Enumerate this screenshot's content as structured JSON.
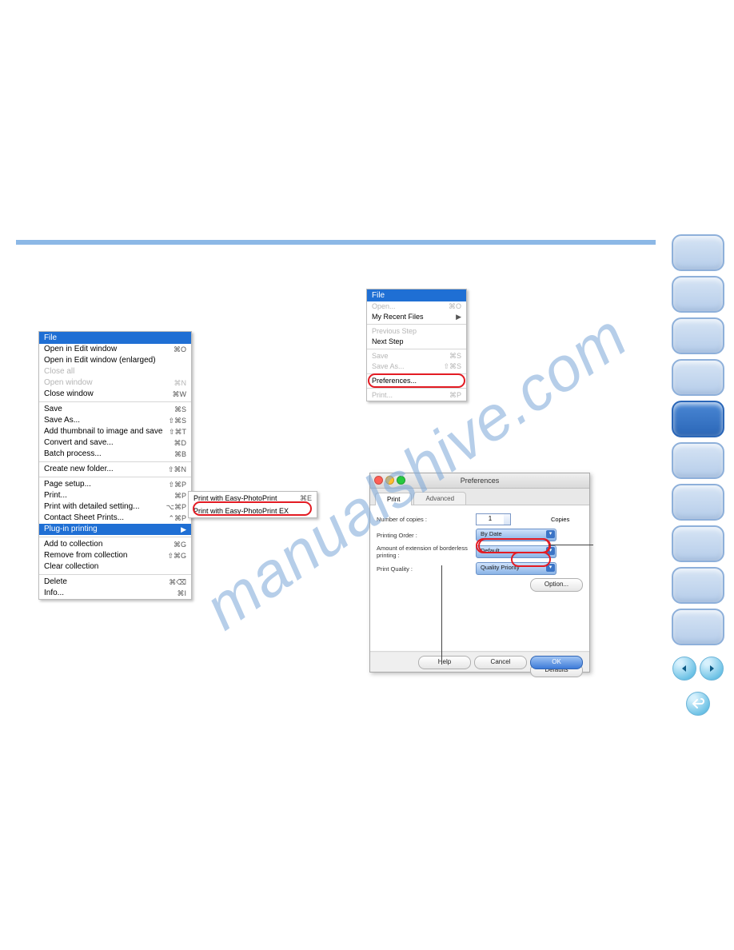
{
  "watermark": "manualshive.com",
  "menu1": {
    "title": "File",
    "rows": [
      {
        "label": "Open in Edit window",
        "sc": "⌘O"
      },
      {
        "label": "Open in Edit window (enlarged)",
        "sc": ""
      },
      {
        "label": "Close all",
        "sc": "",
        "disabled": true
      },
      {
        "label": "Open window",
        "sc": "⌘N",
        "disabled": true
      },
      {
        "label": "Close window",
        "sc": "⌘W"
      },
      {
        "sep": true
      },
      {
        "label": "Save",
        "sc": "⌘S"
      },
      {
        "label": "Save As...",
        "sc": "⇧⌘S"
      },
      {
        "label": "Add thumbnail to image and save",
        "sc": "⇧⌘T"
      },
      {
        "label": "Convert and save...",
        "sc": "⌘D"
      },
      {
        "label": "Batch process...",
        "sc": "⌘B"
      },
      {
        "sep": true
      },
      {
        "label": "Create new folder...",
        "sc": "⇧⌘N"
      },
      {
        "sep": true
      },
      {
        "label": "Page setup...",
        "sc": "⇧⌘P"
      },
      {
        "label": "Print...",
        "sc": "⌘P"
      },
      {
        "label": "Print with detailed setting...",
        "sc": "⌥⌘P"
      },
      {
        "label": "Contact Sheet Prints...",
        "sc": "⌃⌘P"
      },
      {
        "label": "Plug-in printing",
        "sc": "▶",
        "selected": true
      },
      {
        "sep": true
      },
      {
        "label": "Add to collection",
        "sc": "⌘G"
      },
      {
        "label": "Remove from collection",
        "sc": "⇧⌘G"
      },
      {
        "label": "Clear collection",
        "sc": ""
      },
      {
        "sep": true
      },
      {
        "label": "Delete",
        "sc": "⌘⌫"
      },
      {
        "label": "Info...",
        "sc": "⌘I"
      }
    ]
  },
  "submenu": {
    "rows": [
      {
        "label": "Print with Easy-PhotoPrint",
        "sc": "⌘E"
      },
      {
        "label": "Print with Easy-PhotoPrint EX",
        "sc": ""
      }
    ]
  },
  "menu2": {
    "title": "File",
    "rows": [
      {
        "label": "Open...",
        "sc": "⌘O",
        "disabled": true
      },
      {
        "label": "My Recent Files",
        "sc": "▶"
      },
      {
        "sep": true
      },
      {
        "label": "Previous Step",
        "sc": "",
        "disabled": true
      },
      {
        "label": "Next Step",
        "sc": ""
      },
      {
        "sep": true
      },
      {
        "label": "Save",
        "sc": "⌘S",
        "disabled": true
      },
      {
        "label": "Save As...",
        "sc": "⇧⌘S",
        "disabled": true
      },
      {
        "sep": true
      },
      {
        "label": "Preferences...",
        "sc": ""
      },
      {
        "sep": true
      },
      {
        "label": "Print...",
        "sc": "⌘P",
        "disabled": true
      }
    ]
  },
  "dialog": {
    "title": "Preferences",
    "tabs": [
      "Print",
      "Advanced"
    ],
    "fields": {
      "copies_label": "Number of copies :",
      "copies_value": "1",
      "copies_unit": "Copies",
      "order_label": "Printing Order :",
      "order_value": "By Date",
      "ext_label": "Amount of extension of borderless printing :",
      "ext_value": "Default",
      "quality_label": "Print Quality :",
      "quality_value": "Quality Priority",
      "option_btn": "Option...",
      "defaults_btn": "Defaults"
    },
    "buttons": {
      "help": "Help",
      "cancel": "Cancel",
      "ok": "OK"
    }
  }
}
